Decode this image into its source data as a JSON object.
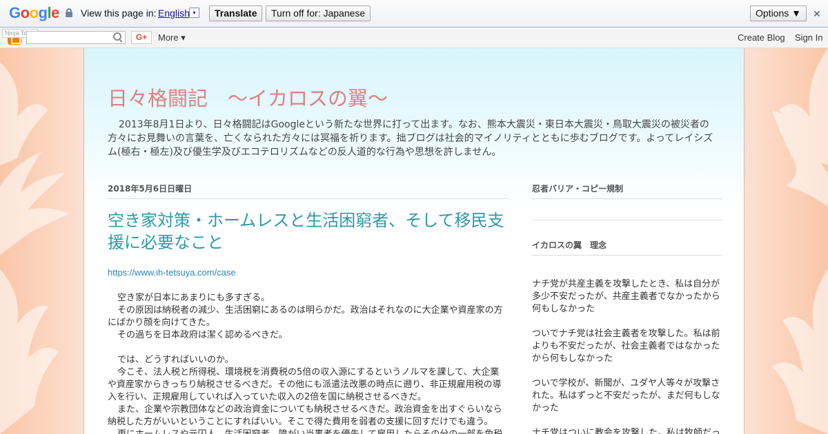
{
  "translate_bar": {
    "logo": "Google",
    "logo_colors": [
      "#4285f4",
      "#ea4335",
      "#fbbc05",
      "#4285f4",
      "#34a853",
      "#ea4335"
    ],
    "view_text": "View this page in:",
    "language": "English",
    "language_arrow": "▾",
    "translate_label": "Translate",
    "turn_off_label": "Turn off for: Japanese",
    "options_label": "Options ▼",
    "close_label": "✕"
  },
  "navbar": {
    "ninja_label": "Ninja Tools",
    "gplus_label": "G+",
    "more_label": "More ▾",
    "create_blog": "Create Blog",
    "sign_in": "Sign In"
  },
  "blog": {
    "title": "日々格闘記　～イカロスの翼～",
    "description": "2013年8月1日より、日々格闘記はGoogleという新たな世界に打って出ます。なお、熊本大震災・東日本大震災・鳥取大震災の被災者の方々にお見舞いの言葉を、亡くなられた方々には冥福を祈ります。拙ブログは社会的マイノリティとともに歩むブログです。よってレイシズム(極右・極左)及び優生学及びエコテロリズムなどの反人道的な行為や思想を許しません。"
  },
  "post": {
    "date": "2018年5月6日日曜日",
    "title": "空き家対策・ホームレスと生活困窮者、そして移民支援に必要なこと",
    "link": "https://www.ih-tetsuya.com/case",
    "paragraphs": [
      "空き家が日本にあまりにも多すぎる。",
      "その原因は納税者の減少、生活困窮にあるのは明らかだ。政治はそれなのに大企業や資産家の方にばかり顔を向けてきた。",
      "その過ちを日本政府は潔く認めるべきだ。",
      "",
      "では、どうすればいいのか。",
      "今こそ、法人税と所得税、環境税を消費税の5倍の収入源にするというノルマを課して、大企業や資産家からきっちり納税させるべきだ。その他にも派遣法改悪の時点に遡り、非正規雇用税の導入を行い、正規雇用していれば入っていた収入の2倍を国に納税させるべきだ。",
      "また、企業や宗教団体などの政治資金についても納税させるべきだ。政治資金を出すぐらいなら納税した方がいいということにすればいい。そこで得た費用を弱者の支援に回すだけでも違う。",
      "更にホームレスや元囚人、生活困窮者、障がい当事者を優先して雇用したらその分の一部を免税"
    ]
  },
  "sidebar": {
    "widget1_title": "忍者バリア・コピー規制",
    "widget2_title": "イカロスの翼　理念",
    "lines": [
      "ナチ党が共産主義を攻撃したとき、私は自分が多少不安だったが、共産主義者でなかったから何もしなかった",
      "",
      "ついでナチ党は社会主義者を攻撃した。私は前よりも不安だったが、社会主義者ではなかったから何もしなかった",
      "",
      "ついで学校が、新聞が、ユダヤ人等々が攻撃された。私はずっと不安だったが、まだ何もしなかった",
      "",
      "ナチ党はついに教会を攻撃した。私は牧師だっ"
    ]
  }
}
